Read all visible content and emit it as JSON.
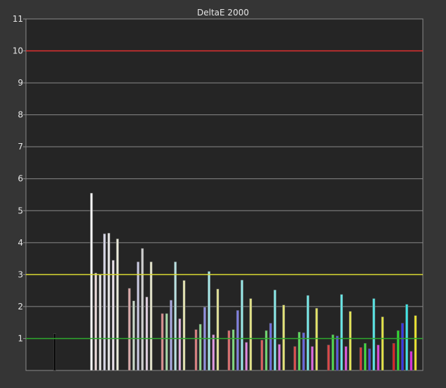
{
  "chart_data": {
    "type": "bar",
    "title": "DeltaE 2000",
    "xlabel": "",
    "ylabel": "",
    "ylim": [
      0,
      11
    ],
    "yticks": [
      1,
      2,
      3,
      4,
      5,
      6,
      7,
      8,
      9,
      10,
      11
    ],
    "grid": true,
    "colors": {
      "background": "#353535",
      "plot_background": "#252525",
      "gridline": "#8a8a8a",
      "text": "#e6e6e6",
      "threshold_high": "#e03030",
      "threshold_mid": "#d8d830",
      "threshold_low": "#2ea82e"
    },
    "reference_lines": [
      {
        "value": 10,
        "color": "#e03030"
      },
      {
        "value": 3,
        "color": "#d8d830"
      },
      {
        "value": 1,
        "color": "#2ea82e"
      }
    ],
    "groups": [
      {
        "bars": [
          {
            "value": 1.15,
            "color": "#0a0a0a"
          }
        ]
      },
      {
        "bars": [
          {
            "value": 5.55,
            "color": "#f5f5f5"
          },
          {
            "value": 3.05,
            "color": "#e8d8d8"
          },
          {
            "value": 3.0,
            "color": "#e4e4e4"
          },
          {
            "value": 4.28,
            "color": "#d8d8e8"
          },
          {
            "value": 4.3,
            "color": "#e8e8e8"
          },
          {
            "value": 3.45,
            "color": "#e8e0e8"
          },
          {
            "value": 4.12,
            "color": "#e8e8d8"
          }
        ]
      },
      {
        "bars": [
          {
            "value": 2.57,
            "color": "#d8a8a8"
          },
          {
            "value": 2.18,
            "color": "#c8d8c8"
          },
          {
            "value": 3.4,
            "color": "#c8c8e0"
          },
          {
            "value": 3.82,
            "color": "#d0d0d0"
          },
          {
            "value": 2.3,
            "color": "#e0d0e0"
          },
          {
            "value": 3.4,
            "color": "#e0e0c8"
          }
        ]
      },
      {
        "bars": [
          {
            "value": 1.78,
            "color": "#d89090"
          },
          {
            "value": 1.78,
            "color": "#a8d8a8"
          },
          {
            "value": 2.2,
            "color": "#a8a8e0"
          },
          {
            "value": 3.4,
            "color": "#b8e0e0"
          },
          {
            "value": 1.62,
            "color": "#e0b0e0"
          },
          {
            "value": 2.82,
            "color": "#e0e0b0"
          }
        ]
      },
      {
        "bars": [
          {
            "value": 1.28,
            "color": "#d88080"
          },
          {
            "value": 1.45,
            "color": "#90d890"
          },
          {
            "value": 1.98,
            "color": "#9090e0"
          },
          {
            "value": 3.1,
            "color": "#a8e8e8"
          },
          {
            "value": 1.12,
            "color": "#e098e0"
          },
          {
            "value": 2.55,
            "color": "#e0e098"
          }
        ]
      },
      {
        "bars": [
          {
            "value": 1.25,
            "color": "#d87070"
          },
          {
            "value": 1.28,
            "color": "#80d880"
          },
          {
            "value": 1.88,
            "color": "#8080e0"
          },
          {
            "value": 2.83,
            "color": "#98e8e8"
          },
          {
            "value": 0.88,
            "color": "#e088e0"
          },
          {
            "value": 2.25,
            "color": "#e0e088"
          }
        ]
      },
      {
        "bars": [
          {
            "value": 0.95,
            "color": "#d86060"
          },
          {
            "value": 1.25,
            "color": "#70d870"
          },
          {
            "value": 1.48,
            "color": "#7070e0"
          },
          {
            "value": 2.52,
            "color": "#88e8e8"
          },
          {
            "value": 0.82,
            "color": "#e078e0"
          },
          {
            "value": 2.05,
            "color": "#e0e078"
          }
        ]
      },
      {
        "bars": [
          {
            "value": 0.75,
            "color": "#d85050"
          },
          {
            "value": 1.2,
            "color": "#60d860"
          },
          {
            "value": 1.18,
            "color": "#6868e0"
          },
          {
            "value": 2.35,
            "color": "#78e8e8"
          },
          {
            "value": 0.75,
            "color": "#e068e0"
          },
          {
            "value": 1.95,
            "color": "#e0e068"
          }
        ]
      },
      {
        "bars": [
          {
            "value": 0.8,
            "color": "#d84848"
          },
          {
            "value": 1.12,
            "color": "#50d850"
          },
          {
            "value": 1.08,
            "color": "#5858e0"
          },
          {
            "value": 2.38,
            "color": "#68e8e8"
          },
          {
            "value": 0.75,
            "color": "#e058e0"
          },
          {
            "value": 1.85,
            "color": "#e0e058"
          }
        ]
      },
      {
        "bars": [
          {
            "value": 0.72,
            "color": "#d83c3c"
          },
          {
            "value": 0.85,
            "color": "#40d840"
          },
          {
            "value": 0.68,
            "color": "#4848e0"
          },
          {
            "value": 2.25,
            "color": "#58e8e8"
          },
          {
            "value": 0.8,
            "color": "#e048e0"
          },
          {
            "value": 1.68,
            "color": "#e0e048"
          }
        ]
      },
      {
        "bars": [
          {
            "value": 0.85,
            "color": "#d82828"
          },
          {
            "value": 1.25,
            "color": "#30d830"
          },
          {
            "value": 1.48,
            "color": "#3838e8"
          },
          {
            "value": 2.07,
            "color": "#40e8e8"
          },
          {
            "value": 0.6,
            "color": "#e030e0"
          },
          {
            "value": 1.72,
            "color": "#e8e030"
          }
        ]
      }
    ]
  }
}
